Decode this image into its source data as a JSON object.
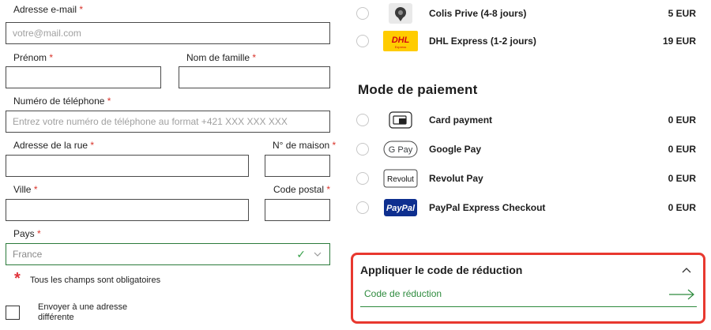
{
  "form": {
    "email": {
      "label": "Adresse e-mail",
      "placeholder": "votre@mail.com"
    },
    "first_name": {
      "label": "Prénom",
      "value": ""
    },
    "last_name": {
      "label": "Nom de famille",
      "value": ""
    },
    "phone": {
      "label": "Numéro de téléphone",
      "placeholder": "Entrez votre numéro de téléphone au format +421 XXX XXX XXX"
    },
    "street": {
      "label": "Adresse de la rue",
      "value": ""
    },
    "house_number": {
      "label": "N° de maison",
      "value": ""
    },
    "city": {
      "label": "Ville",
      "value": ""
    },
    "postal_code": {
      "label": "Code postal",
      "value": ""
    },
    "country": {
      "label": "Pays",
      "value": "France"
    },
    "required_marker": "*",
    "required_note": "Tous les champs sont obligatoires",
    "different_address": "Envoyer à une adresse différente"
  },
  "shipping": [
    {
      "name": "Colis Prive (4-8 jours)",
      "price": "5 EUR",
      "logo": "colis-prive-logo"
    },
    {
      "name": "DHL Express (1-2 jours)",
      "price": "19 EUR",
      "logo": "dhl-logo",
      "logo_text": "DHL",
      "logo_sub": "Express"
    }
  ],
  "payment": {
    "title": "Mode de paiement",
    "methods": [
      {
        "name": "Card payment",
        "price": "0 EUR",
        "logo": "card-icon"
      },
      {
        "name": "Google Pay",
        "price": "0 EUR",
        "logo": "google-pay-logo",
        "logo_text": "G Pay"
      },
      {
        "name": "Revolut Pay",
        "price": "0 EUR",
        "logo": "revolut-logo",
        "logo_text": "Revolut"
      },
      {
        "name": "PayPal Express Checkout",
        "price": "0 EUR",
        "logo": "paypal-logo",
        "logo_text": "PayPal"
      }
    ]
  },
  "promo": {
    "title": "Appliquer le code de réduction",
    "field_label": "Code de réduction"
  },
  "colors": {
    "accent_green": "#2e8b3e",
    "highlight_red": "#e8382f",
    "required_red": "#d9342b"
  }
}
